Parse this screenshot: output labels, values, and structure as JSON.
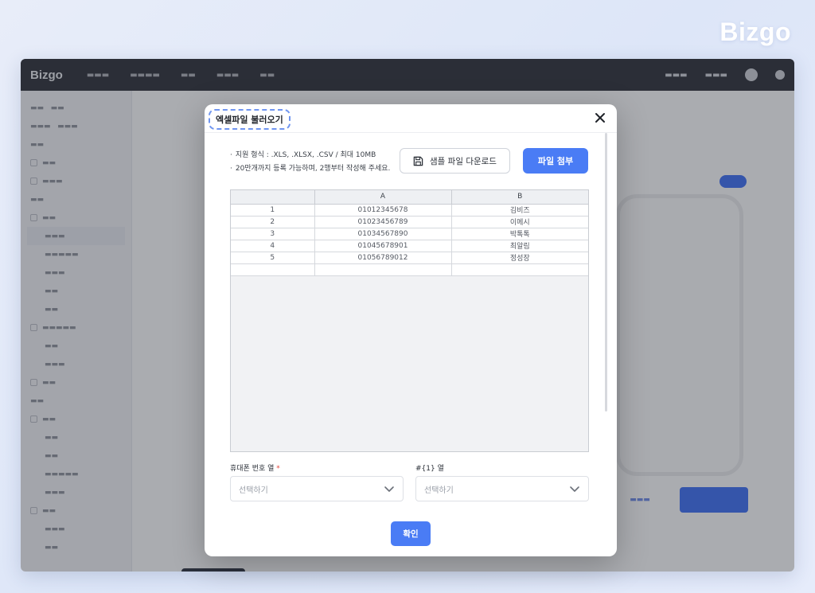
{
  "brand": {
    "logo_text": "Bizgo"
  },
  "background_app": {
    "logo_text": "Bizgo",
    "accent_color": "#3b6cf0"
  },
  "modal": {
    "title": "엑셀파일 불러오기",
    "info_lines": [
      "지원 형식 : .XLS, .XLSX, .CSV / 최대 10MB",
      "20만개까지 등록 가능하며, 2행부터 작성해 주세요."
    ],
    "sample_download_label": "샘플 파일 다운로드",
    "attach_label": "파일 첨부",
    "sheet": {
      "columns": [
        "",
        "A",
        "B"
      ],
      "rows": [
        [
          "1",
          "01012345678",
          "김비즈"
        ],
        [
          "2",
          "01023456789",
          "이메시"
        ],
        [
          "3",
          "01034567890",
          "박톡톡"
        ],
        [
          "4",
          "01045678901",
          "최알림"
        ],
        [
          "5",
          "01056789012",
          "정성장"
        ],
        [
          "",
          "",
          ""
        ]
      ]
    },
    "phone_column": {
      "label": "휴대폰 번호 열",
      "required_mark": "*",
      "placeholder": "선택하기"
    },
    "var_column": {
      "label": "#{1} 열",
      "placeholder": "선택하기"
    },
    "confirm_label": "확인",
    "primary_color": "#4a7cf5"
  }
}
